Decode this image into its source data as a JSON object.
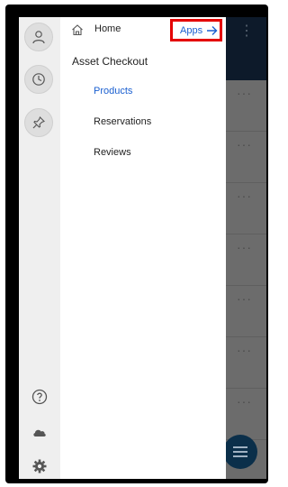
{
  "drawer": {
    "home_label": "Home",
    "apps_label": "Apps",
    "section_title": "Asset Checkout",
    "items": [
      {
        "label": "Products",
        "active": true
      },
      {
        "label": "Reservations",
        "active": false
      },
      {
        "label": "Reviews",
        "active": false
      }
    ]
  },
  "rail": {
    "top_icons": [
      "person-icon",
      "clock-icon",
      "pin-icon"
    ],
    "bottom_icons": [
      "help-icon",
      "cloud-icon",
      "gear-icon"
    ]
  },
  "background_app": {
    "more_glyph": "⋮",
    "row_more_glyph": "···",
    "rows": 7
  },
  "colors": {
    "accent": "#1a5fd0",
    "highlight_border": "#e40000",
    "topbar": "#0d1a2a",
    "fab": "#0b2f4a"
  }
}
